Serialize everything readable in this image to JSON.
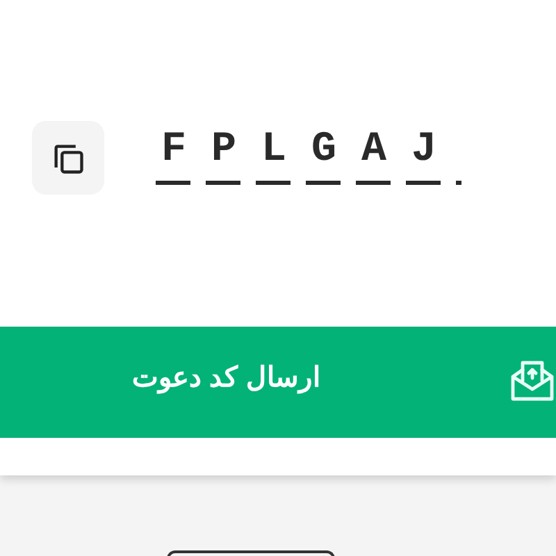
{
  "invite_code": {
    "code": "FPLGAJ"
  },
  "send_button": {
    "label": "ارسال کد دعوت"
  }
}
